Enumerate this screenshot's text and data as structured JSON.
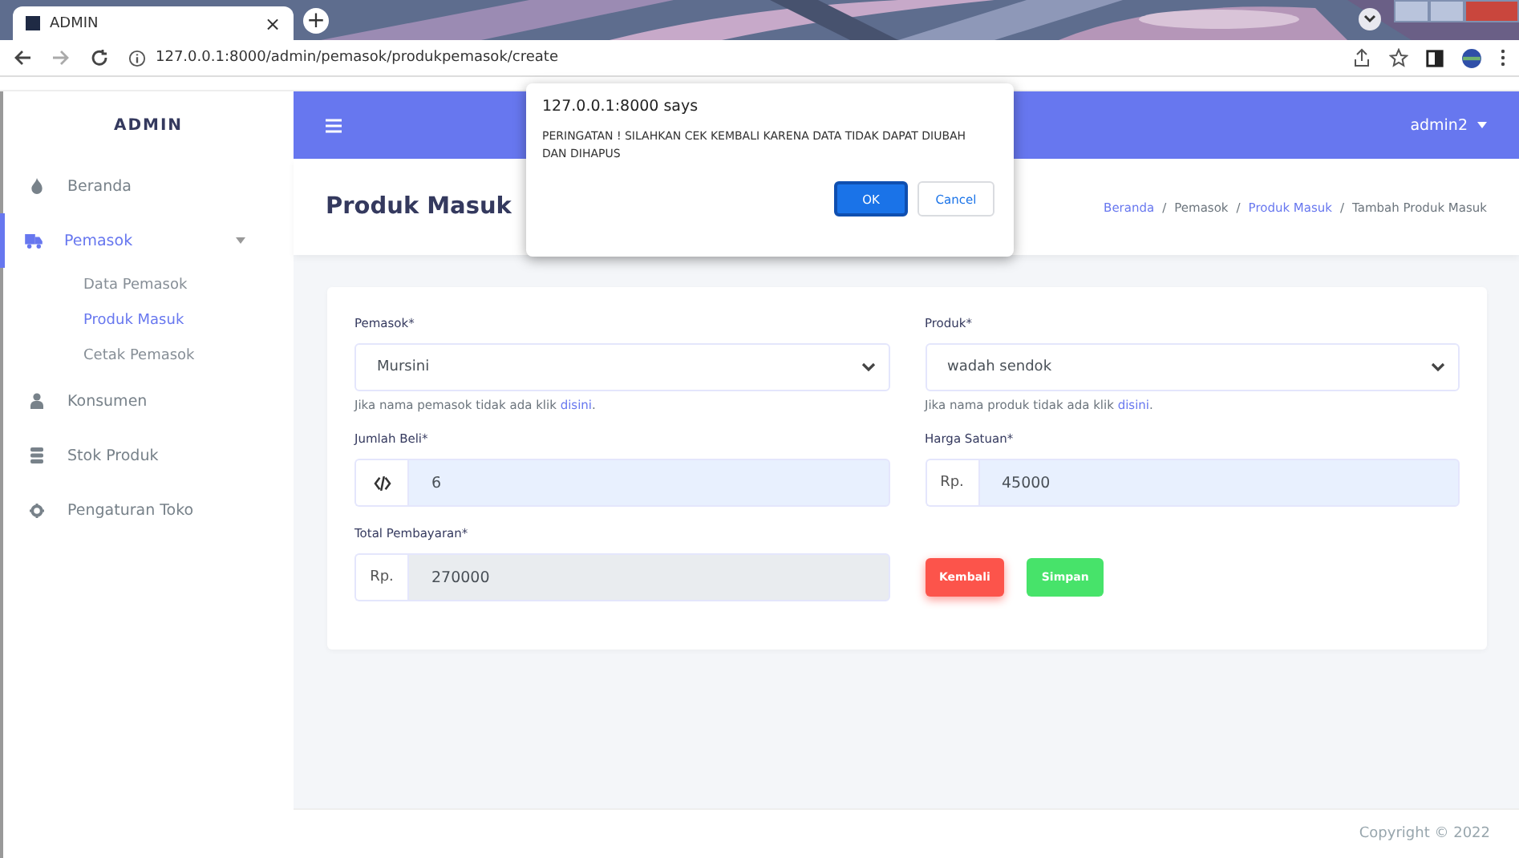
{
  "browser": {
    "tab_title": "ADMIN",
    "tab_close": "×",
    "new_tab": "+",
    "url": "127.0.0.1:8000/admin/pemasok/produkpemasok/create"
  },
  "sidebar": {
    "brand": "ADMIN",
    "items": [
      {
        "label": "Beranda",
        "selected": false
      },
      {
        "label": "Pemasok",
        "selected": true,
        "expanded": true,
        "children": [
          {
            "label": "Data Pemasok",
            "selected": false
          },
          {
            "label": "Produk Masuk",
            "selected": true
          },
          {
            "label": "Cetak Pemasok",
            "selected": false
          }
        ]
      },
      {
        "label": "Konsumen",
        "selected": false
      },
      {
        "label": "Stok Produk",
        "selected": false
      },
      {
        "label": "Pengaturan Toko",
        "selected": false
      }
    ]
  },
  "topbar": {
    "user": "admin2"
  },
  "page": {
    "title": "Produk Masuk",
    "breadcrumb_separator": "/",
    "breadcrumb": [
      {
        "label": "Beranda",
        "kind": "link"
      },
      {
        "label": "Pemasok",
        "kind": "text"
      },
      {
        "label": "Produk Masuk",
        "kind": "link"
      },
      {
        "label": "Tambah Produk Masuk",
        "kind": "text"
      }
    ]
  },
  "form": {
    "fields": [
      {
        "label": "Pemasok*",
        "kind": "select",
        "value": "Mursini",
        "help": "Jika nama pemasok tidak ada klik",
        "help_link": "disini",
        "help_end": "."
      },
      {
        "label": "Produk*",
        "kind": "select",
        "value": "wadah sendok",
        "help": "Jika nama produk tidak ada klik",
        "help_link": "disini",
        "help_end": "."
      },
      {
        "label": "Jumlah Beli*",
        "kind": "input",
        "value": "6",
        "autofilled": true,
        "disabled": false
      },
      {
        "label": "Harga Satuan*",
        "kind": "input",
        "prefix": "Rp.",
        "value": "45000",
        "autofilled": true,
        "disabled": false
      },
      {
        "label": "Total Pembayaran*",
        "kind": "input",
        "prefix": "Rp.",
        "value": "270000",
        "autofilled": false,
        "disabled": true
      }
    ],
    "buttons": [
      {
        "label": "Kembali",
        "kind": "danger"
      },
      {
        "label": "Simpan",
        "kind": "success"
      }
    ]
  },
  "footer": "Copyright © 2022",
  "dialog": {
    "origin": "127.0.0.1:8000 says",
    "message": "PERINGATAN ! SILAHKAN CEK KEMBALI KARENA DATA TIDAK DAPAT DIUBAH DAN DIHAPUS",
    "buttons": [
      {
        "label": "OK",
        "kind": "primary"
      },
      {
        "label": "Cancel",
        "kind": "secondary"
      }
    ]
  }
}
